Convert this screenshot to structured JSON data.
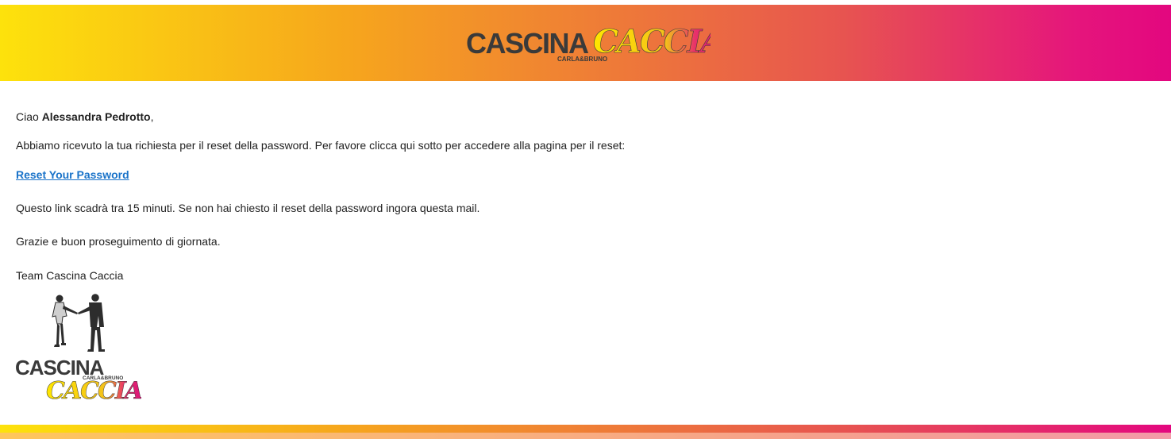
{
  "header": {
    "logo_name": "cascina-caccia-logo",
    "logo_text_main": "CASCINA",
    "logo_text_accent": "CACCIA",
    "logo_subtext": "CARLA&BRUNO"
  },
  "email": {
    "greeting_prefix": "Ciao ",
    "recipient_name": "Alessandra Pedrotto",
    "greeting_suffix": ",",
    "body": "Abbiamo ricevuto la tua richiesta per il reset della password. Per favore clicca qui sotto per accedere alla pagina per il reset:",
    "reset_link_label": "Reset Your Password",
    "expiry_notice": "Questo link scadrà tra 15 minuti. Se non hai chiesto il reset della password ingora questa mail.",
    "thanks": "Grazie e buon proseguimento di giornata.",
    "signature": "Team Cascina Caccia"
  },
  "footer": {
    "logo_text_main": "CASCINA",
    "logo_text_accent": "CACCIA",
    "logo_subtext": "CARLA&BRUNO"
  },
  "colors": {
    "gradient_start": "#fde20c",
    "gradient_mid": "#ef7f35",
    "gradient_end": "#e3077f",
    "link": "#1a73c9",
    "logo_dark": "#3a3a3a"
  }
}
